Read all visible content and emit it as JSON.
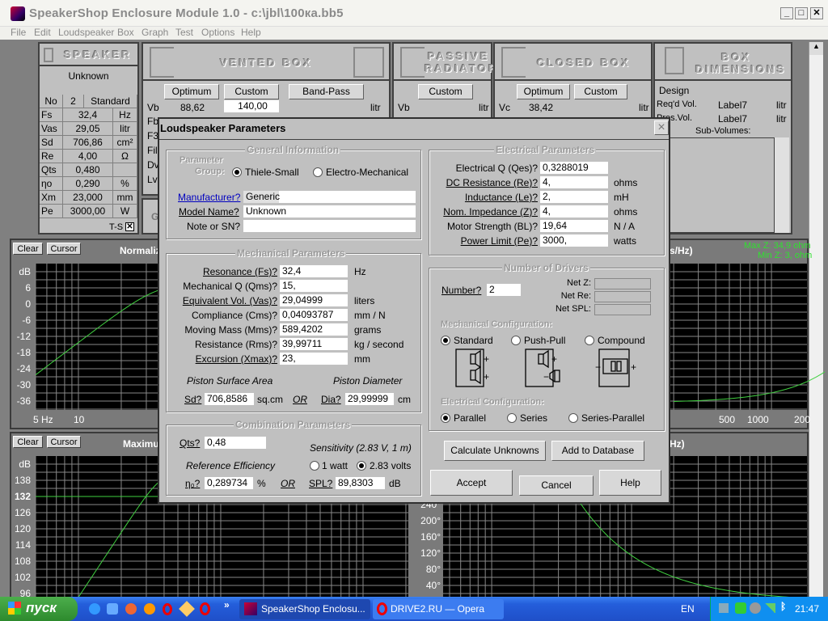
{
  "window": {
    "title": "SpeakerShop Enclosure Module 1.0 - c:\\jbl\\100ка.bb5",
    "minimize": "_",
    "maximize": "□",
    "close": "✕"
  },
  "menu": [
    "File",
    "Edit",
    "Loudspeaker",
    "Box",
    "Graph",
    "Test",
    "Options",
    "Help"
  ],
  "speaker": {
    "header": "SPEAKER",
    "name": "Unknown",
    "no_label": "No",
    "no_value": "2",
    "config": "Standard",
    "rows": [
      {
        "k": "Fs",
        "v": "32,4",
        "u": "Hz"
      },
      {
        "k": "Vas",
        "v": "29,05",
        "u": "litr"
      },
      {
        "k": "Sd",
        "v": "706,86",
        "u": "cm²"
      },
      {
        "k": "Re",
        "v": "4,00",
        "u": "Ω"
      },
      {
        "k": "Qts",
        "v": "0,480",
        "u": ""
      },
      {
        "k": "ηo",
        "v": "0,290",
        "u": "%"
      },
      {
        "k": "Xm",
        "v": "23,000",
        "u": "mm"
      },
      {
        "k": "Pe",
        "v": "3000,00",
        "u": "W"
      }
    ],
    "ts_label": "T-S",
    "ts_checked": true
  },
  "vented": {
    "header": "VENTED BOX",
    "optimum": "Optimum",
    "custom": "Custom",
    "bandpass": "Band-Pass",
    "vb_label": "Vb",
    "vb_opt": "88,62",
    "vb_custom": "140,00",
    "unit": "litr",
    "row_labels": [
      "Fb",
      "F3",
      "Fil",
      "Dv",
      "Lv"
    ],
    "g_label": "G"
  },
  "passive": {
    "header1": "PASSIVE",
    "header2": "RADIATOR",
    "custom": "Custom",
    "vb_label": "Vb",
    "unit": "litr"
  },
  "closed": {
    "header": "CLOSED BOX",
    "optimum": "Optimum",
    "custom": "Custom",
    "vc_label": "Vc",
    "vc_opt": "38,42",
    "unit": "litr"
  },
  "boxdim": {
    "header1": "BOX",
    "header2": "DIMENSIONS",
    "design": "Design",
    "reqd": "Req'd Vol.",
    "pres": "Pres.Vol.",
    "reqd_val": "Label7",
    "pres_val": "Label7",
    "unit": "litr",
    "subvol": "Sub-Volumes:"
  },
  "graphs": {
    "clear": "Clear",
    "cursor": "Cursor",
    "top_title": "Normaliz",
    "top_title_right": "s/Hz)",
    "impedance_max": "Max Z: 34,9 ohm",
    "impedance_min": "Min Z: 3, ohm",
    "bottom_title": "Maximu",
    "bottom_title_right": "Hz)",
    "top_y": [
      "dB",
      "6",
      "0",
      "-6",
      "-12",
      "-18",
      "-24",
      "-30",
      "-36"
    ],
    "top_x_left": [
      "5 Hz",
      "10"
    ],
    "top_x_right": [
      "500",
      "1000",
      "200"
    ],
    "bottom_y": [
      "dB",
      "138",
      "132",
      "126",
      "120",
      "114",
      "108",
      "102",
      "96"
    ],
    "bottom_y_right": [
      "240°",
      "200°",
      "160°",
      "120°",
      "80°",
      "40°"
    ],
    "curve_color": "#40d040"
  },
  "dialog": {
    "title": "Loudspeaker Parameters",
    "close": "×",
    "general": {
      "title": "General Information",
      "param_label1": "Parameter",
      "param_label2": "Group:",
      "thiele": "Thiele-Small",
      "electro": "Electro-Mechanical",
      "thiele_selected": true,
      "manufacturer_label": "Manufacturer?",
      "manufacturer": "Generic",
      "model_label": "Model Name?",
      "model": "Unknown",
      "note_label": "Note or SN?",
      "note": ""
    },
    "mechanical": {
      "title": "Mechanical Parameters",
      "rows": [
        {
          "label": "Resonance (Fs)?",
          "value": "32,4",
          "unit": "Hz",
          "ul": true
        },
        {
          "label": "Mechanical Q (Qms)?",
          "value": "15,",
          "unit": "",
          "ul": false
        },
        {
          "label": "Equivalent Vol. (Vas)?",
          "value": "29,04999",
          "unit": "liters",
          "ul": true
        },
        {
          "label": "Compliance (Cms)?",
          "value": "0,04093787",
          "unit": "mm / N",
          "ul": false
        },
        {
          "label": "Moving Mass (Mms)?",
          "value": "589,4202",
          "unit": "grams",
          "ul": false
        },
        {
          "label": "Resistance (Rms)?",
          "value": "39,99711",
          "unit": "kg / second",
          "ul": false
        },
        {
          "label": "Excursion (Xmax)?",
          "value": "23,",
          "unit": "mm",
          "ul": true
        }
      ],
      "psa": "Piston Surface Area",
      "pd": "Piston Diameter",
      "sd_label": "Sd?",
      "sd": "706,8586",
      "sd_unit": "sq.cm",
      "or": "OR",
      "dia_label": "Dia?",
      "dia": "29,99999",
      "dia_unit": "cm"
    },
    "combination": {
      "title": "Combination Parameters",
      "qts_label": "Qts?",
      "qts": "0,48",
      "sensitivity": "Sensitivity (2.83 V, 1 m)",
      "ref_eff": "Reference Efficiency",
      "watt": "1 watt",
      "volts": "2.83 volts",
      "volts_selected": true,
      "eta_label": "η₀?",
      "eta": "0,289734",
      "eta_unit": "%",
      "or": "OR",
      "spl_label": "SPL?",
      "spl": "89,8303",
      "spl_unit": "dB"
    },
    "electrical": {
      "title": "Electrical Parameters",
      "rows": [
        {
          "label": "Electrical Q (Qes)?",
          "value": "0,3288019",
          "unit": "",
          "ul": false
        },
        {
          "label": "DC Resistance (Re)?",
          "value": "4,",
          "unit": "ohms",
          "ul": true
        },
        {
          "label": "Inductance (Le)?",
          "value": "2,",
          "unit": "mH",
          "ul": true
        },
        {
          "label": "Nom. Impedance (Z)?",
          "value": "4,",
          "unit": "ohms",
          "ul": true
        },
        {
          "label": "Motor Strength (BL)?",
          "value": "19,64",
          "unit": "N / A",
          "ul": false
        },
        {
          "label": "Power Limit (Pe)?",
          "value": "3000,",
          "unit": "watts",
          "ul": true
        }
      ]
    },
    "drivers": {
      "title": "Number of Drivers",
      "number_label": "Number?",
      "number": "2",
      "netz": "Net Z:",
      "netre": "Net Re:",
      "netspl": "Net SPL:",
      "mech_title": "Mechanical Configuration:",
      "standard": "Standard",
      "pushpull": "Push-Pull",
      "compound": "Compound",
      "mech_selected": "Standard",
      "elec_title": "Electrical Configuration:",
      "parallel": "Parallel",
      "series": "Series",
      "seriesparallel": "Series-Parallel",
      "elec_selected": "Parallel"
    },
    "calculate": "Calculate Unknowns",
    "add_db": "Add to Database",
    "accept": "Accept",
    "cancel": "Cancel",
    "help": "Help"
  },
  "taskbar": {
    "start": "пуск",
    "tasks": [
      "SpeakerShop Enclosu...",
      "DRIVE2.RU — Opera"
    ],
    "more": "»",
    "lang": "EN",
    "clock": "21:47"
  }
}
